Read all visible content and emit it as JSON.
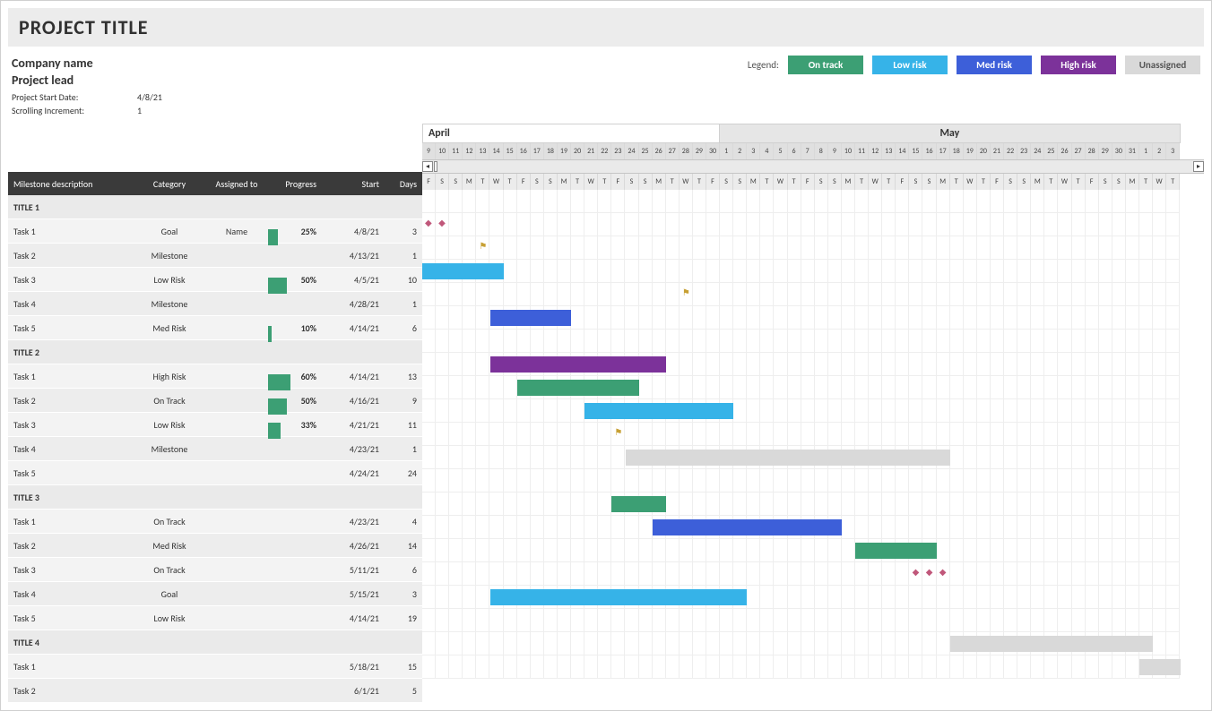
{
  "title": "PROJECT TITLE",
  "meta": {
    "company": "Company name",
    "lead": "Project lead",
    "start_date_label": "Project Start Date:",
    "start_date": "4/8/21",
    "scroll_label": "Scrolling Increment:",
    "scroll_value": "1"
  },
  "legend": {
    "label": "Legend:",
    "ontrack": "On track",
    "low": "Low risk",
    "med": "Med risk",
    "high": "High risk",
    "unassigned": "Unassigned"
  },
  "columns": {
    "desc": "Milestone description",
    "cat": "Category",
    "asg": "Assigned to",
    "prog": "Progress",
    "start": "Start",
    "days": "Days"
  },
  "calendar": {
    "first_day_index": 0,
    "months": [
      {
        "label": "April",
        "span": 22
      },
      {
        "label": "May",
        "span": 34
      }
    ],
    "days": [
      9,
      10,
      11,
      12,
      13,
      14,
      15,
      16,
      17,
      18,
      19,
      20,
      21,
      22,
      23,
      24,
      25,
      26,
      27,
      28,
      29,
      30,
      1,
      2,
      3,
      4,
      5,
      6,
      7,
      8,
      9,
      10,
      11,
      12,
      13,
      14,
      15,
      16,
      17,
      18,
      19,
      20,
      21,
      22,
      23,
      24,
      25,
      26,
      27,
      28,
      29,
      30,
      31,
      1,
      2,
      3
    ],
    "dow": [
      "F",
      "S",
      "S",
      "M",
      "T",
      "W",
      "T",
      "F",
      "S",
      "S",
      "M",
      "T",
      "W",
      "T",
      "F",
      "S",
      "S",
      "M",
      "T",
      "W",
      "T",
      "F",
      "S",
      "S",
      "M",
      "T",
      "W",
      "T",
      "F",
      "S",
      "S",
      "M",
      "T",
      "W",
      "T",
      "F",
      "S",
      "S",
      "M",
      "T",
      "W",
      "T",
      "F",
      "S",
      "S",
      "M",
      "T",
      "W",
      "T",
      "F",
      "S",
      "S",
      "M",
      "T",
      "W",
      "T"
    ]
  },
  "groups": [
    {
      "title": "TITLE 1",
      "rows": [
        {
          "desc": "Task 1",
          "cat": "Goal",
          "asg": "Name",
          "prog": 25,
          "start": "4/8/21",
          "days": 3,
          "bar": null,
          "markers": [
            {
              "type": "diamond",
              "col": 0
            },
            {
              "type": "diamond",
              "col": 1
            }
          ]
        },
        {
          "desc": "Task 2",
          "cat": "Milestone",
          "asg": "",
          "prog": null,
          "start": "4/13/21",
          "days": 1,
          "bar": null,
          "markers": [
            {
              "type": "flag",
              "col": 4
            }
          ]
        },
        {
          "desc": "Task 3",
          "cat": "Low Risk",
          "asg": "",
          "prog": 50,
          "start": "4/5/21",
          "days": 10,
          "bar": {
            "class": "low",
            "col": 0,
            "span": 6
          },
          "markers": []
        },
        {
          "desc": "Task 4",
          "cat": "Milestone",
          "asg": "",
          "prog": null,
          "start": "4/28/21",
          "days": 1,
          "bar": null,
          "markers": [
            {
              "type": "flag",
              "col": 19
            }
          ]
        },
        {
          "desc": "Task 5",
          "cat": "Med Risk",
          "asg": "",
          "prog": 10,
          "start": "4/14/21",
          "days": 6,
          "bar": {
            "class": "med",
            "col": 5,
            "span": 6
          },
          "markers": []
        }
      ]
    },
    {
      "title": "TITLE 2",
      "rows": [
        {
          "desc": "Task 1",
          "cat": "High Risk",
          "asg": "",
          "prog": 60,
          "start": "4/14/21",
          "days": 13,
          "bar": {
            "class": "high",
            "col": 5,
            "span": 13
          },
          "markers": []
        },
        {
          "desc": "Task 2",
          "cat": "On Track",
          "asg": "",
          "prog": 50,
          "start": "4/16/21",
          "days": 9,
          "bar": {
            "class": "ontrack",
            "col": 7,
            "span": 9
          },
          "markers": []
        },
        {
          "desc": "Task 3",
          "cat": "Low Risk",
          "asg": "",
          "prog": 33,
          "start": "4/21/21",
          "days": 11,
          "bar": {
            "class": "low",
            "col": 12,
            "span": 11
          },
          "markers": []
        },
        {
          "desc": "Task 4",
          "cat": "Milestone",
          "asg": "",
          "prog": null,
          "start": "4/23/21",
          "days": 1,
          "bar": null,
          "markers": [
            {
              "type": "flag",
              "col": 14
            }
          ]
        },
        {
          "desc": "Task 5",
          "cat": "",
          "asg": "",
          "prog": null,
          "start": "4/24/21",
          "days": 24,
          "bar": {
            "class": "unassigned",
            "col": 15,
            "span": 24
          },
          "markers": []
        }
      ]
    },
    {
      "title": "TITLE 3",
      "rows": [
        {
          "desc": "Task 1",
          "cat": "On Track",
          "asg": "",
          "prog": null,
          "start": "4/23/21",
          "days": 4,
          "bar": {
            "class": "ontrack",
            "col": 14,
            "span": 4
          },
          "markers": []
        },
        {
          "desc": "Task 2",
          "cat": "Med Risk",
          "asg": "",
          "prog": null,
          "start": "4/26/21",
          "days": 14,
          "bar": {
            "class": "med",
            "col": 17,
            "span": 14
          },
          "markers": []
        },
        {
          "desc": "Task 3",
          "cat": "On Track",
          "asg": "",
          "prog": null,
          "start": "5/11/21",
          "days": 6,
          "bar": {
            "class": "ontrack",
            "col": 32,
            "span": 6
          },
          "markers": []
        },
        {
          "desc": "Task 4",
          "cat": "Goal",
          "asg": "",
          "prog": null,
          "start": "5/15/21",
          "days": 3,
          "bar": null,
          "markers": [
            {
              "type": "diamond",
              "col": 36
            },
            {
              "type": "diamond",
              "col": 37
            },
            {
              "type": "diamond",
              "col": 38
            }
          ]
        },
        {
          "desc": "Task 5",
          "cat": "Low Risk",
          "asg": "",
          "prog": null,
          "start": "4/14/21",
          "days": 19,
          "bar": {
            "class": "low",
            "col": 5,
            "span": 19
          },
          "markers": []
        }
      ]
    },
    {
      "title": "TITLE 4",
      "rows": [
        {
          "desc": "Task 1",
          "cat": "",
          "asg": "",
          "prog": null,
          "start": "5/18/21",
          "days": 15,
          "bar": {
            "class": "unassigned",
            "col": 39,
            "span": 15
          },
          "markers": []
        },
        {
          "desc": "Task 2",
          "cat": "",
          "asg": "",
          "prog": null,
          "start": "6/1/21",
          "days": 5,
          "bar": {
            "class": "unassigned",
            "col": 53,
            "span": 3
          },
          "markers": []
        }
      ]
    }
  ],
  "chart_data": {
    "type": "gantt",
    "timeline_start": "2021-04-09",
    "timeline_end": "2021-06-03",
    "series": [
      {
        "group": "TITLE 1",
        "name": "Task 1",
        "category": "Goal",
        "assigned": "Name",
        "progress": 25,
        "start": "2021-04-08",
        "days": 3
      },
      {
        "group": "TITLE 1",
        "name": "Task 2",
        "category": "Milestone",
        "start": "2021-04-13",
        "days": 1
      },
      {
        "group": "TITLE 1",
        "name": "Task 3",
        "category": "Low Risk",
        "progress": 50,
        "start": "2021-04-05",
        "days": 10
      },
      {
        "group": "TITLE 1",
        "name": "Task 4",
        "category": "Milestone",
        "start": "2021-04-28",
        "days": 1
      },
      {
        "group": "TITLE 1",
        "name": "Task 5",
        "category": "Med Risk",
        "progress": 10,
        "start": "2021-04-14",
        "days": 6
      },
      {
        "group": "TITLE 2",
        "name": "Task 1",
        "category": "High Risk",
        "progress": 60,
        "start": "2021-04-14",
        "days": 13
      },
      {
        "group": "TITLE 2",
        "name": "Task 2",
        "category": "On Track",
        "progress": 50,
        "start": "2021-04-16",
        "days": 9
      },
      {
        "group": "TITLE 2",
        "name": "Task 3",
        "category": "Low Risk",
        "progress": 33,
        "start": "2021-04-21",
        "days": 11
      },
      {
        "group": "TITLE 2",
        "name": "Task 4",
        "category": "Milestone",
        "start": "2021-04-23",
        "days": 1
      },
      {
        "group": "TITLE 2",
        "name": "Task 5",
        "category": "Unassigned",
        "start": "2021-04-24",
        "days": 24
      },
      {
        "group": "TITLE 3",
        "name": "Task 1",
        "category": "On Track",
        "start": "2021-04-23",
        "days": 4
      },
      {
        "group": "TITLE 3",
        "name": "Task 2",
        "category": "Med Risk",
        "start": "2021-04-26",
        "days": 14
      },
      {
        "group": "TITLE 3",
        "name": "Task 3",
        "category": "On Track",
        "start": "2021-05-11",
        "days": 6
      },
      {
        "group": "TITLE 3",
        "name": "Task 4",
        "category": "Goal",
        "start": "2021-05-15",
        "days": 3
      },
      {
        "group": "TITLE 3",
        "name": "Task 5",
        "category": "Low Risk",
        "start": "2021-04-14",
        "days": 19
      },
      {
        "group": "TITLE 4",
        "name": "Task 1",
        "category": "Unassigned",
        "start": "2021-05-18",
        "days": 15
      },
      {
        "group": "TITLE 4",
        "name": "Task 2",
        "category": "Unassigned",
        "start": "2021-06-01",
        "days": 5
      }
    ]
  }
}
